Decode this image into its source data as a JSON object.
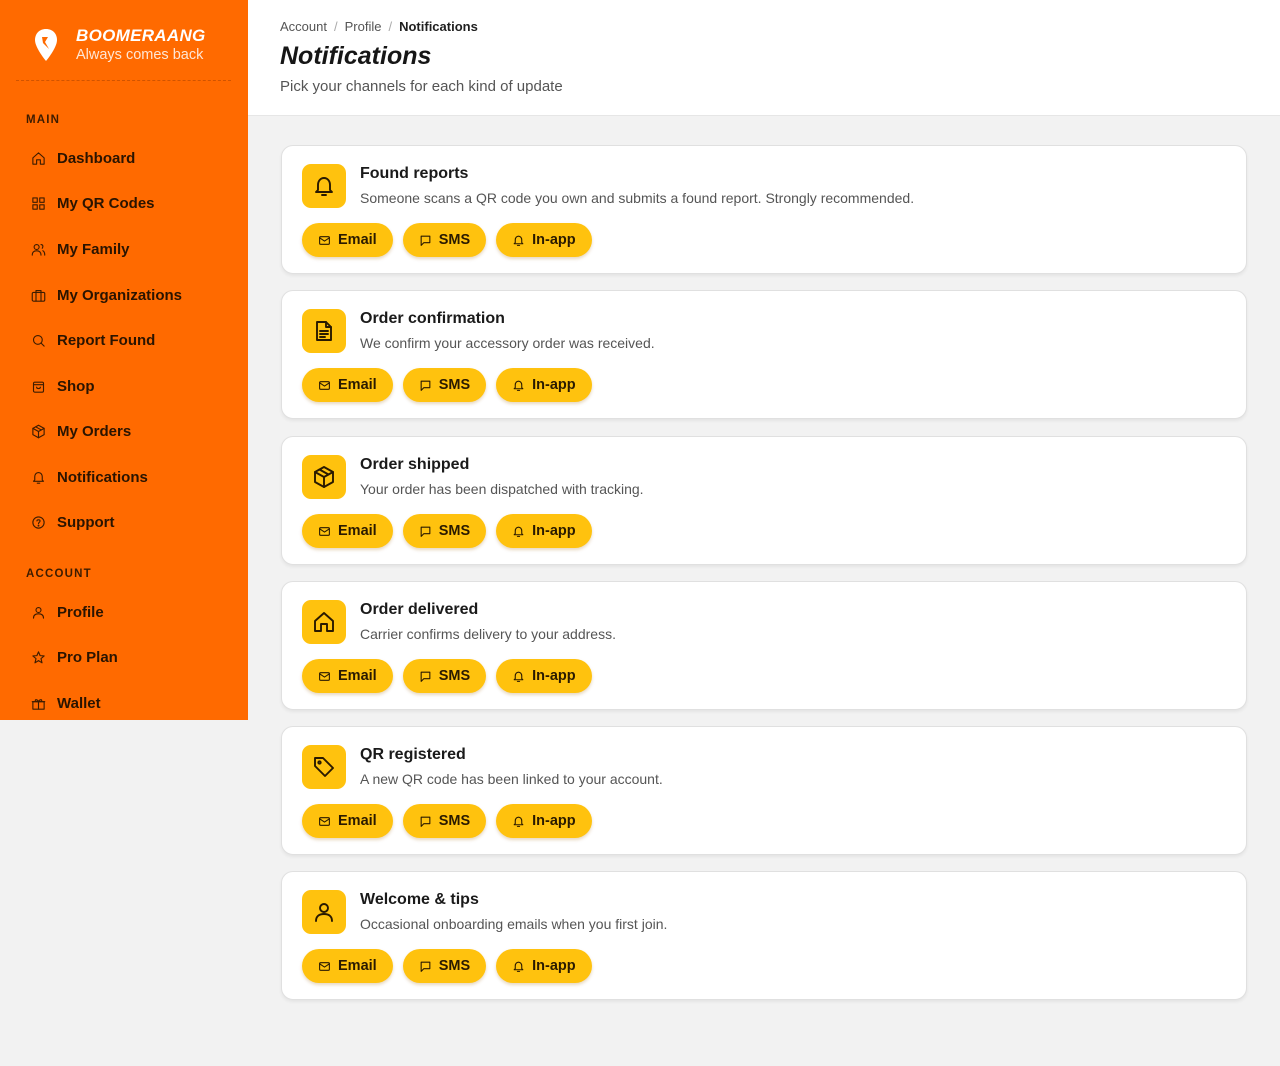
{
  "brand": {
    "name": "BOOMERAANG",
    "tagline": "Always comes back"
  },
  "sidebar": {
    "main_section": "MAIN",
    "main_items": [
      {
        "label": "Dashboard",
        "icon": "home-icon"
      },
      {
        "label": "My QR Codes",
        "icon": "grid-icon"
      },
      {
        "label": "My Family",
        "icon": "users-icon"
      },
      {
        "label": "My Organizations",
        "icon": "briefcase-icon"
      },
      {
        "label": "Report Found",
        "icon": "search-icon"
      },
      {
        "label": "Shop",
        "icon": "shopping-bag-icon"
      },
      {
        "label": "My Orders",
        "icon": "package-icon"
      },
      {
        "label": "Notifications",
        "icon": "bell-icon"
      },
      {
        "label": "Support",
        "icon": "help-circle-icon"
      }
    ],
    "account_section": "ACCOUNT",
    "account_items": [
      {
        "label": "Profile",
        "icon": "user-icon"
      },
      {
        "label": "Pro Plan",
        "icon": "star-icon"
      },
      {
        "label": "Wallet",
        "icon": "gift-icon"
      }
    ]
  },
  "header": {
    "breadcrumb": [
      "Account",
      "Profile",
      "Notifications"
    ],
    "title": "Notifications",
    "subtitle": "Pick your channels for each kind of update"
  },
  "channel_labels": {
    "email": "Email",
    "sms": "SMS",
    "inapp": "In-app"
  },
  "cards": [
    {
      "icon": "bell-icon",
      "title": "Found reports",
      "description": "Someone scans a QR code you own and submits a found report. Strongly recommended."
    },
    {
      "icon": "document-icon",
      "title": "Order confirmation",
      "description": "We confirm your accessory order was received."
    },
    {
      "icon": "package-icon",
      "title": "Order shipped",
      "description": "Your order has been dispatched with tracking."
    },
    {
      "icon": "home-icon",
      "title": "Order delivered",
      "description": "Carrier confirms delivery to your address."
    },
    {
      "icon": "tag-icon",
      "title": "QR registered",
      "description": "A new QR code has been linked to your account."
    },
    {
      "icon": "user-icon",
      "title": "Welcome & tips",
      "description": "Occasional onboarding emails when you first join."
    }
  ],
  "colors": {
    "sidebar": "#ff6a00",
    "accent": "#ffc20e",
    "background": "#f2f2f2"
  }
}
